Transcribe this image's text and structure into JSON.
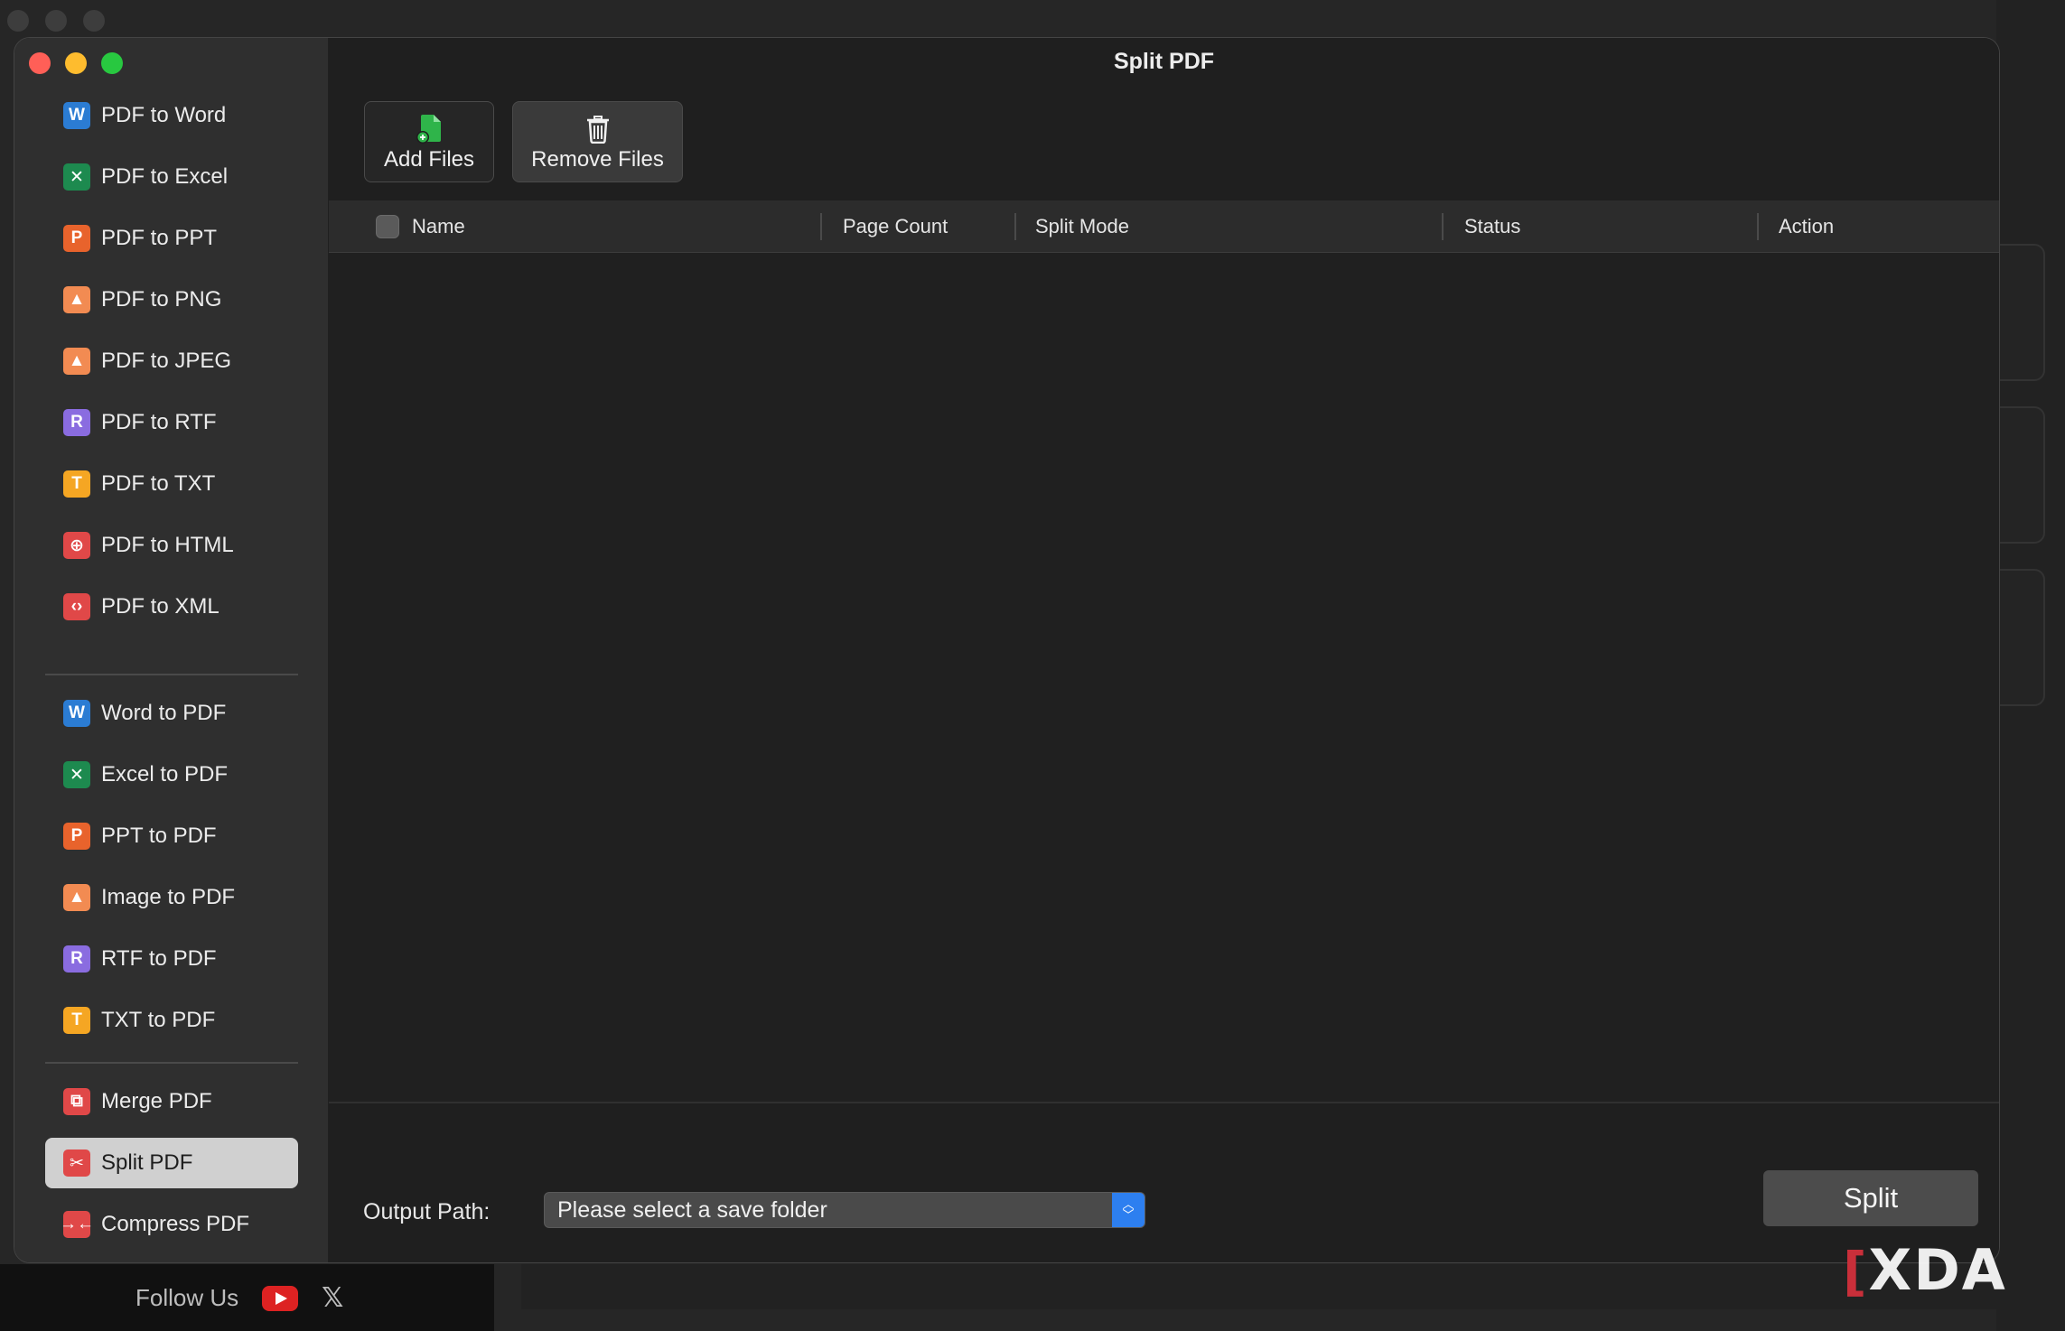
{
  "window": {
    "title": "Split PDF"
  },
  "sidebar": {
    "group1": [
      {
        "label": "PDF to Word",
        "icon": "word-icon",
        "glyph": "W",
        "color": "#2b7cd3"
      },
      {
        "label": "PDF to Excel",
        "icon": "excel-icon",
        "glyph": "✕",
        "color": "#1d8a4f"
      },
      {
        "label": "PDF to PPT",
        "icon": "ppt-icon",
        "glyph": "P",
        "color": "#e8632c"
      },
      {
        "label": "PDF to PNG",
        "icon": "image-icon",
        "glyph": "▲",
        "color": "#f28b52"
      },
      {
        "label": "PDF to JPEG",
        "icon": "image-icon",
        "glyph": "▲",
        "color": "#f28b52"
      },
      {
        "label": "PDF to RTF",
        "icon": "rtf-icon",
        "glyph": "R",
        "color": "#8a6ce0"
      },
      {
        "label": "PDF to TXT",
        "icon": "txt-icon",
        "glyph": "T",
        "color": "#f5a623"
      },
      {
        "label": "PDF to HTML",
        "icon": "globe-icon",
        "glyph": "⊕",
        "color": "#e04848"
      },
      {
        "label": "PDF to XML",
        "icon": "code-icon",
        "glyph": "‹›",
        "color": "#e04848"
      }
    ],
    "group2": [
      {
        "label": "Word to PDF",
        "icon": "word-icon",
        "glyph": "W",
        "color": "#2b7cd3"
      },
      {
        "label": "Excel to PDF",
        "icon": "excel-icon",
        "glyph": "✕",
        "color": "#1d8a4f"
      },
      {
        "label": "PPT to PDF",
        "icon": "ppt-icon",
        "glyph": "P",
        "color": "#e8632c"
      },
      {
        "label": "Image to PDF",
        "icon": "image-icon",
        "glyph": "▲",
        "color": "#f28b52"
      },
      {
        "label": "RTF to PDF",
        "icon": "rtf-icon",
        "glyph": "R",
        "color": "#8a6ce0"
      },
      {
        "label": "TXT to PDF",
        "icon": "txt-icon",
        "glyph": "T",
        "color": "#f5a623"
      }
    ],
    "group3": [
      {
        "label": "Merge PDF",
        "icon": "merge-icon",
        "glyph": "⧉",
        "color": "#e04848"
      },
      {
        "label": "Split PDF",
        "icon": "scissors-icon",
        "glyph": "✂",
        "color": "#e04848",
        "active": true
      },
      {
        "label": "Compress PDF",
        "icon": "compress-icon",
        "glyph": "→←",
        "color": "#e04848"
      }
    ]
  },
  "toolbar": {
    "add_label": "Add Files",
    "remove_label": "Remove Files"
  },
  "table": {
    "columns": [
      "Name",
      "Page Count",
      "Split Mode",
      "Status",
      "Action"
    ]
  },
  "output": {
    "label": "Output Path:",
    "value": "Please select a save folder"
  },
  "actions": {
    "split_label": "Split"
  },
  "footer": {
    "follow_label": "Follow Us"
  },
  "watermark": "XDA"
}
